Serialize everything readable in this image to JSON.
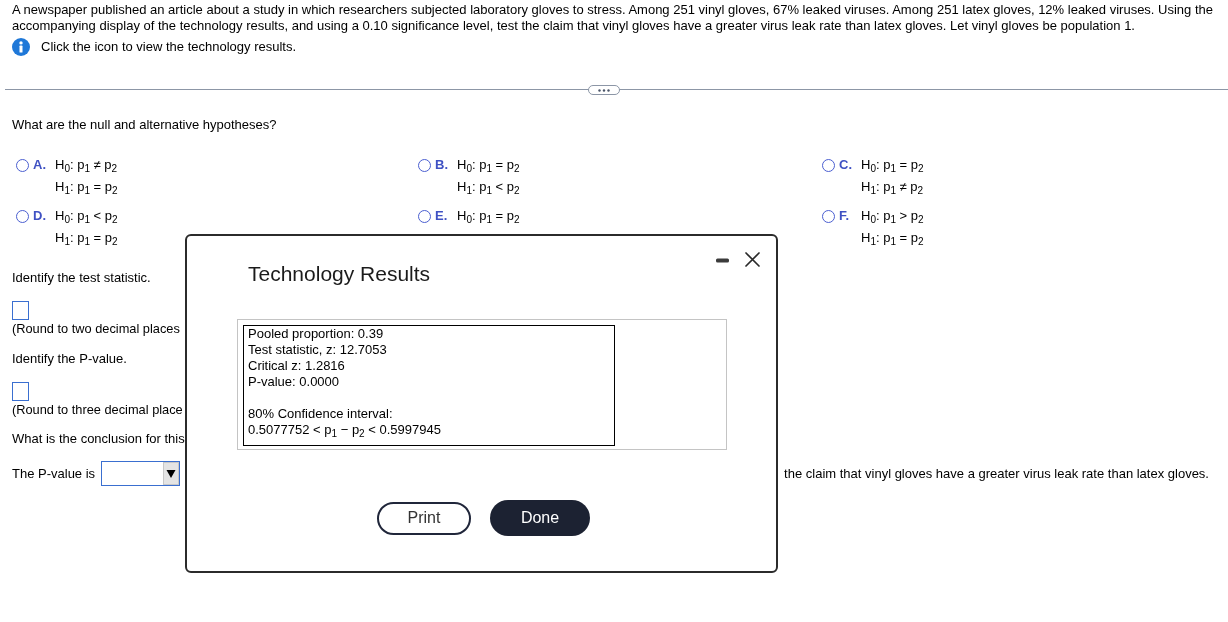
{
  "problem": {
    "text": "A newspaper published an article about a study in which researchers subjected laboratory gloves to stress. Among 251 vinyl gloves, 67% leaked viruses. Among 251 latex gloves, 12% leaked viruses. Using the accompanying display of the technology results, and using a 0.10 significance level, test the claim that vinyl gloves have a greater virus leak rate than latex gloves. Let vinyl gloves be population 1.",
    "info_text": "Click the icon to view the technology results."
  },
  "question_1": {
    "prompt": "What are the null and alternative hypotheses?",
    "options": [
      {
        "letter": "A.",
        "h0": "H$_{0}$: p$_{1}$ ≠ p$_{2}$",
        "h1": "H$_{1}$: p$_{1}$ = p$_{2}$",
        "selected": false
      },
      {
        "letter": "B.",
        "h0": "H$_{0}$: p$_{1}$ = p$_{2}$",
        "h1": "H$_{1}$: p$_{1}$ < p$_{2}$",
        "selected": false
      },
      {
        "letter": "C.",
        "h0": "H$_{0}$: p$_{1}$ = p$_{2}$",
        "h1": "H$_{1}$: p$_{1}$ ≠ p$_{2}$",
        "selected": false
      },
      {
        "letter": "D.",
        "h0": "H$_{0}$: p$_{1}$ < p$_{2}$",
        "h1": "H$_{1}$: p$_{1}$ = p$_{2}$",
        "selected": false
      },
      {
        "letter": "E.",
        "h0": "H$_{0}$: p$_{1}$ = p$_{2}$",
        "selected": false
      },
      {
        "letter": "F.",
        "h0": "H$_{0}$: p$_{1}$ > p$_{2}$",
        "h1": "H$_{1}$: p$_{1}$ = p$_{2}$",
        "selected": false
      }
    ]
  },
  "question_2": {
    "prompt": "Identify the test statistic.",
    "hint": "(Round to two decimal places"
  },
  "question_3": {
    "prompt": "Identify the P-value.",
    "hint": "(Round to three decimal place"
  },
  "question_4": {
    "prompt": "What is the conclusion for this",
    "lead": "The P-value is",
    "tail": "the claim that vinyl gloves have a greater virus leak rate than latex gloves."
  },
  "dialog": {
    "title": "Technology Results",
    "stats": [
      "Pooled proportion: 0.39",
      "Test statistic, z: 12.7053",
      "Critical z: 1.2816",
      "P-value: 0.0000"
    ],
    "interval_title": "80% Confidence interval:",
    "interval": "0.5077752 < p$_{1}$ − p$_{2}$ < 0.5997945",
    "buttons": [
      {
        "label": "Print",
        "kind": "secondary"
      },
      {
        "label": "Done",
        "kind": "primary"
      }
    ]
  }
}
